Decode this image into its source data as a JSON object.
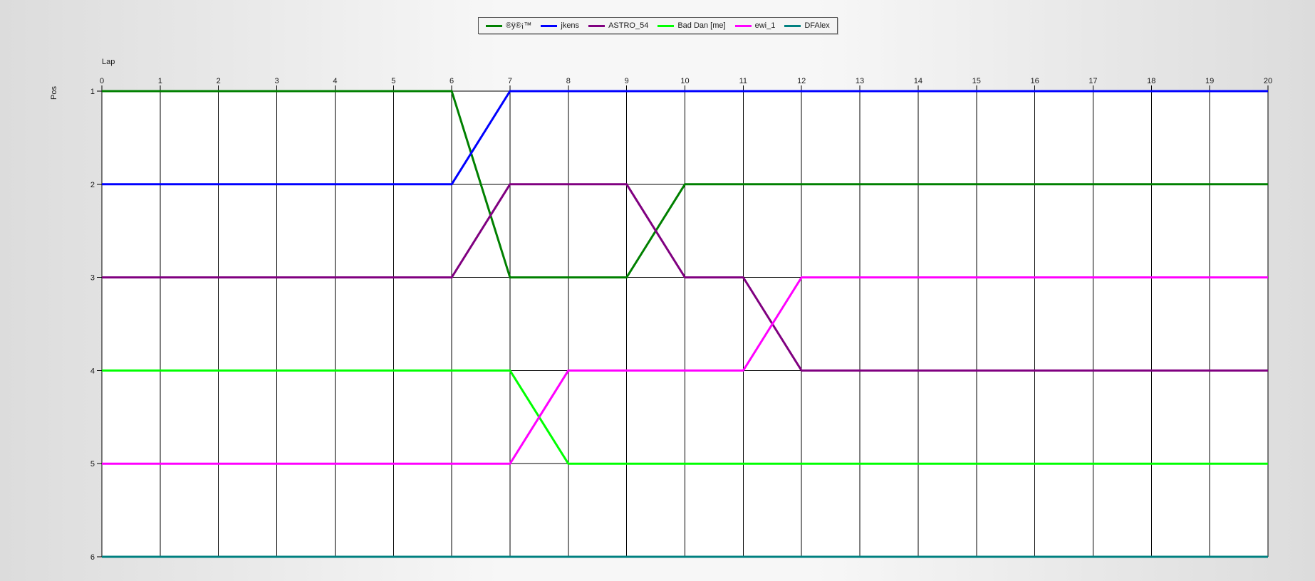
{
  "chart_data": {
    "type": "line",
    "title": "",
    "xlabel": "Lap",
    "ylabel": "Pos",
    "x": [
      0,
      1,
      2,
      3,
      4,
      5,
      6,
      7,
      8,
      9,
      10,
      11,
      12,
      13,
      14,
      15,
      16,
      17,
      18,
      19,
      20
    ],
    "xlim": [
      0,
      20
    ],
    "ylim": [
      1,
      6
    ],
    "y_inverted": true,
    "y_ticks": [
      1,
      2,
      3,
      4,
      5,
      6
    ],
    "grid": true,
    "legend_position": "top-center",
    "series": [
      {
        "name": "®ÿ®¡™",
        "color": "#008000",
        "values": [
          1,
          1,
          1,
          1,
          1,
          1,
          1,
          3,
          3,
          3,
          2,
          2,
          2,
          2,
          2,
          2,
          2,
          2,
          2,
          2,
          2
        ]
      },
      {
        "name": "jkens",
        "color": "#0000ff",
        "values": [
          2,
          2,
          2,
          2,
          2,
          2,
          2,
          1,
          1,
          1,
          1,
          1,
          1,
          1,
          1,
          1,
          1,
          1,
          1,
          1,
          1
        ]
      },
      {
        "name": "ASTRO_54",
        "color": "#800080",
        "values": [
          3,
          3,
          3,
          3,
          3,
          3,
          3,
          2,
          2,
          2,
          3,
          3,
          4,
          4,
          4,
          4,
          4,
          4,
          4,
          4,
          4
        ]
      },
      {
        "name": "Bad Dan [me]",
        "color": "#00ff00",
        "values": [
          4,
          4,
          4,
          4,
          4,
          4,
          4,
          4,
          5,
          5,
          5,
          5,
          5,
          5,
          5,
          5,
          5,
          5,
          5,
          5,
          5
        ]
      },
      {
        "name": "ewi_1",
        "color": "#ff00ff",
        "values": [
          5,
          5,
          5,
          5,
          5,
          5,
          5,
          5,
          4,
          4,
          4,
          4,
          3,
          3,
          3,
          3,
          3,
          3,
          3,
          3,
          3
        ]
      },
      {
        "name": "DFAlex",
        "color": "#008080",
        "values": [
          6,
          6,
          6,
          6,
          6,
          6,
          6,
          6,
          6,
          6,
          6,
          6,
          6,
          6,
          6,
          6,
          6,
          6,
          6,
          6,
          6
        ]
      }
    ]
  }
}
